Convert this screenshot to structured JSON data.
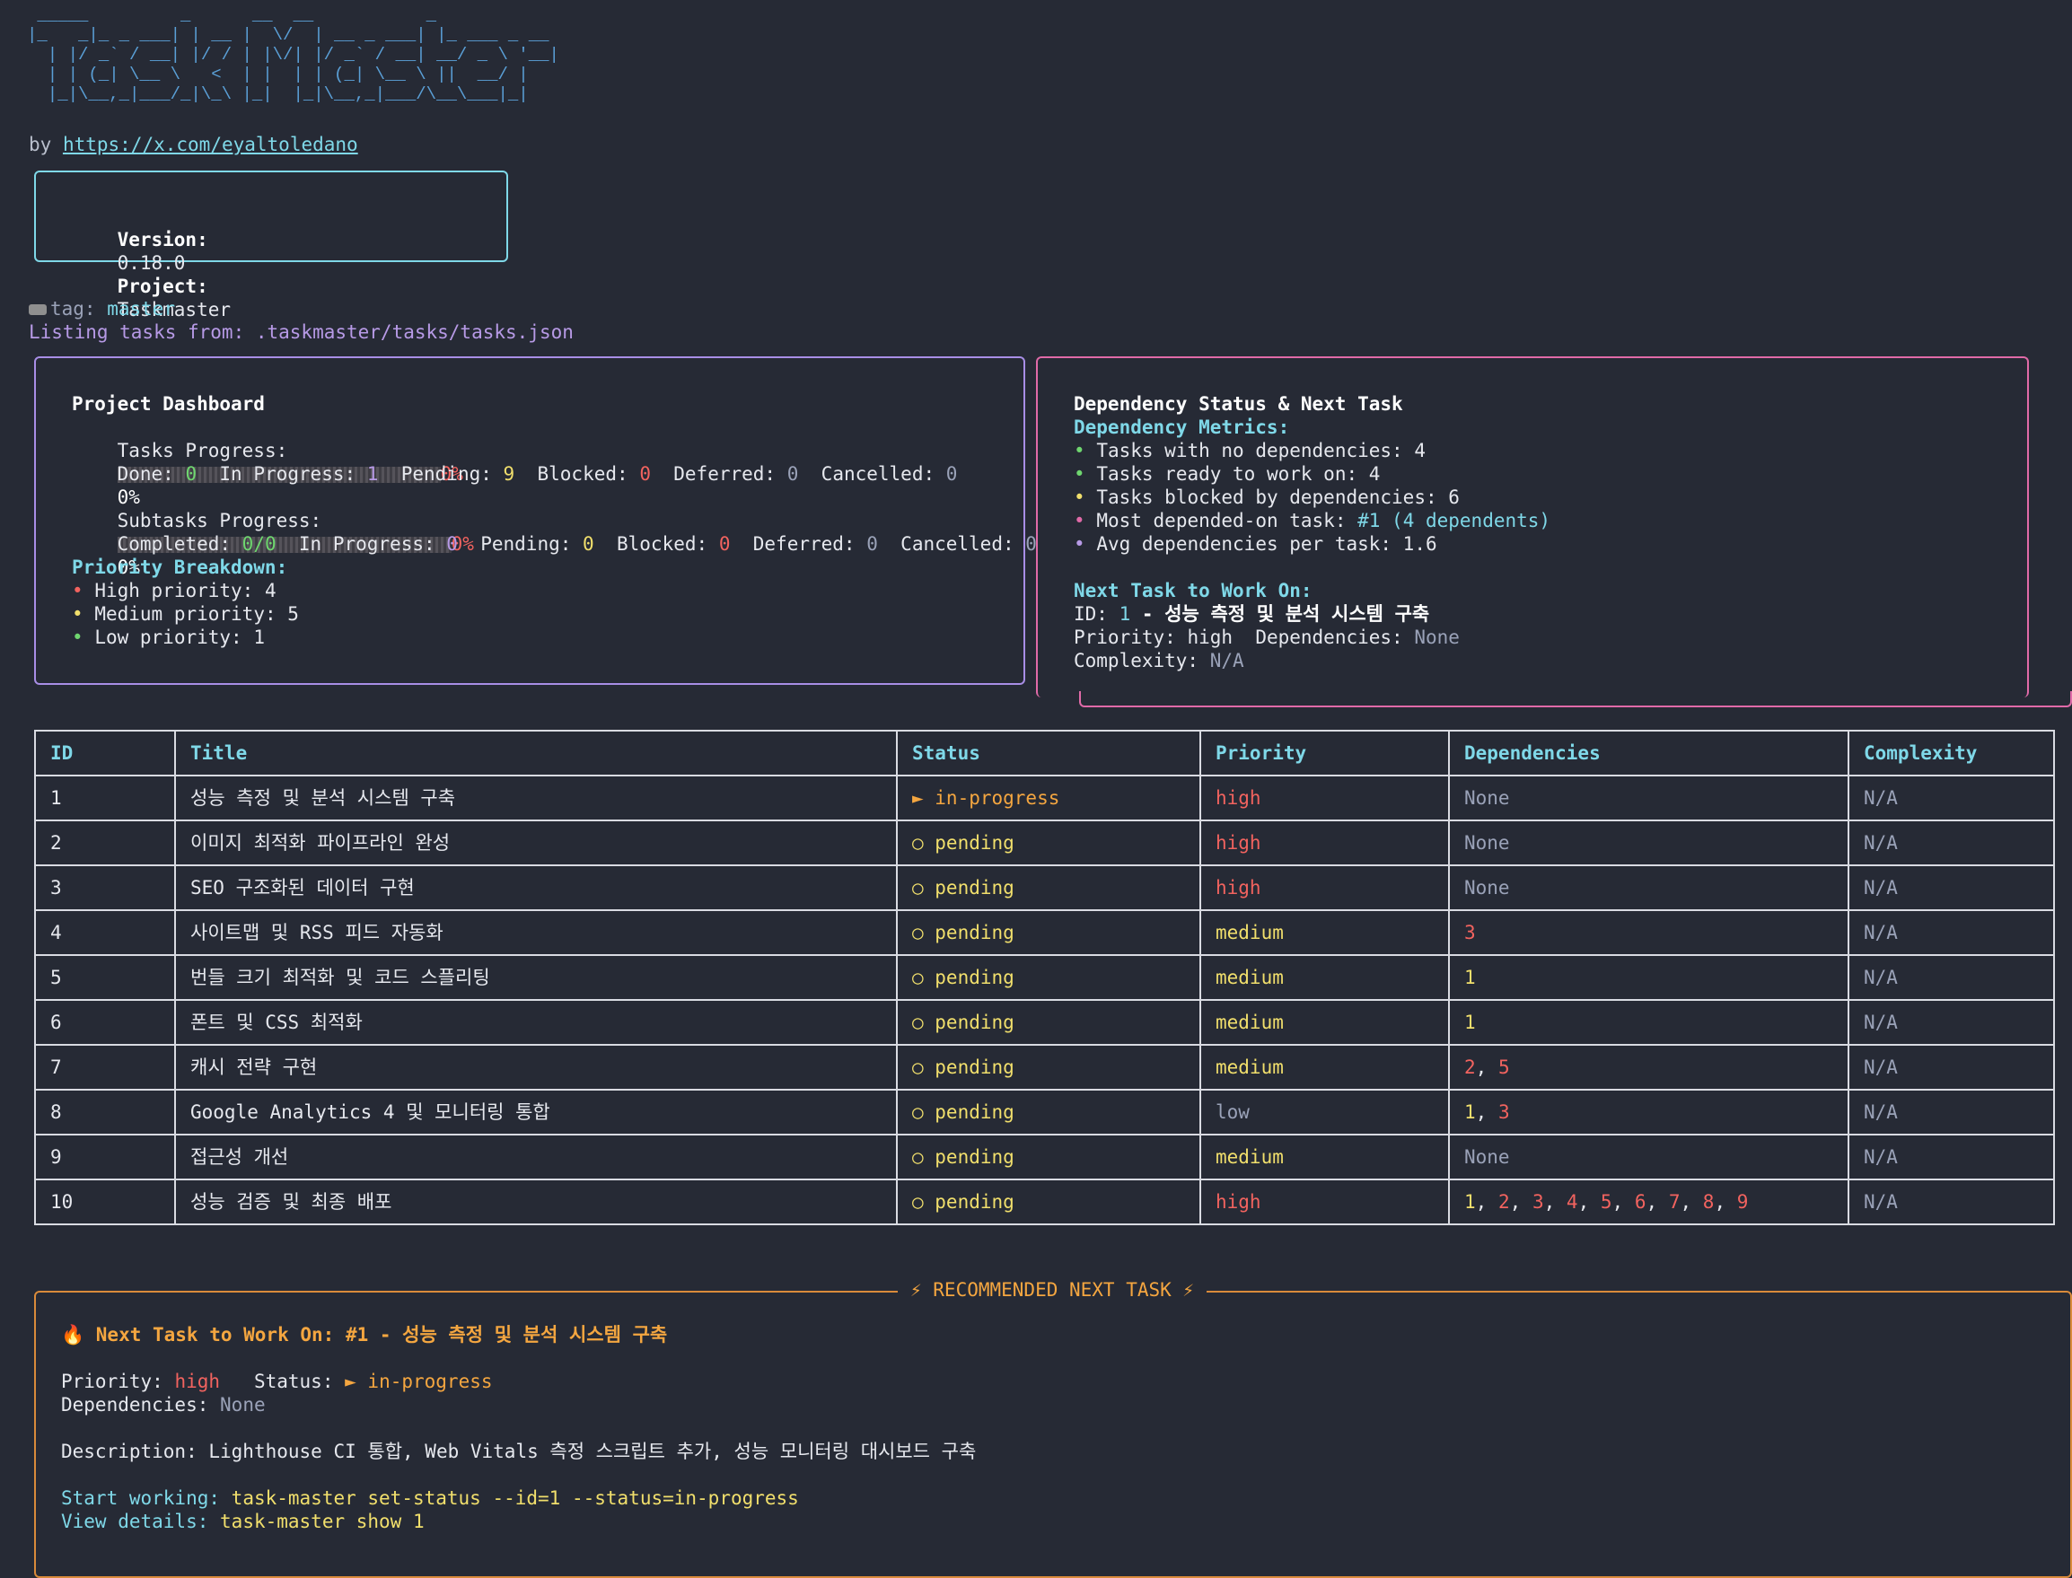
{
  "header": {
    "logo_ascii": " _____         _      __  __           _\n|_   _|_ _ ___| | __ |  \\/  | __ _ ___| |_ ___ _ __\n  | |/ _` / __| |/ / | |\\/| |/ _` / __| __/ _ \\ '__|\n  | | (_| \\__ \\   <  | |  | | (_| \\__ \\ ||  __/ |\n  |_|\\__,_|___/_|\\_\\ |_|  |_|\\__,_|___/\\__\\___|_|",
    "by_label": "by",
    "author_link": "https://x.com/eyaltoledano",
    "version_label": "Version:",
    "version": "0.18.0",
    "project_label": "Project:",
    "project": "Taskmaster",
    "tag_label": "tag:",
    "tag": "master",
    "listing_text": "Listing tasks from: .taskmaster/tasks/tasks.json"
  },
  "dashboard": {
    "title": "Project Dashboard",
    "tasks_progress_label": "Tasks Progress:",
    "tasks_progress_pct": "0%",
    "tasks_progress_pct2": "0%",
    "done_label": "Done:",
    "done": "0",
    "inprogress_label": "In Progress:",
    "inprogress": "1",
    "pending_label": "Pending:",
    "pending": "9",
    "blocked_label": "Blocked:",
    "blocked": "0",
    "deferred_label": "Deferred:",
    "deferred": "0",
    "cancelled_label": "Cancelled:",
    "cancelled": "0",
    "subtasks_progress_label": "Subtasks Progress:",
    "subtasks_progress_pct": "0%",
    "subtasks_progress_pct2": "0%",
    "completed_label": "Completed:",
    "completed": "0/0",
    "s_inprogress_label": "In Progress:",
    "s_inprogress": "0",
    "s_pending_label": "Pending:",
    "s_pending": "0",
    "s_blocked_label": "Blocked:",
    "s_blocked": "0",
    "s_deferred_label": "Deferred:",
    "s_deferred": "0",
    "s_cancelled_label": "Cancelled:",
    "s_cancelled": "0",
    "priority_title": "Priority Breakdown:",
    "high": "High priority: 4",
    "medium": "Medium priority: 5",
    "low": "Low priority: 1"
  },
  "dependency": {
    "title": "Dependency Status & Next Task",
    "metrics_title": "Dependency Metrics:",
    "no_deps": "Tasks with no dependencies: 4",
    "ready": "Tasks ready to work on: 4",
    "blocked": "Tasks blocked by dependencies: 6",
    "most_label": "Most depended-on task:",
    "most_value": "#1 (4 dependents)",
    "avg": "Avg dependencies per task: 1.6",
    "next_title": "Next Task to Work On:",
    "id_label": "ID:",
    "id": "1",
    "task_title": "- 성능 측정 및 분석 시스템 구축",
    "priority_label": "Priority:",
    "priority": "high",
    "deps_label": "Dependencies:",
    "deps": "None",
    "complexity_label": "Complexity:",
    "complexity": "N/A"
  },
  "table": {
    "headers": [
      "ID",
      "Title",
      "Status",
      "Priority",
      "Dependencies",
      "Complexity"
    ],
    "rows": [
      {
        "id": "1",
        "title": "성능 측정 및 분석 시스템 구축",
        "status": "► in-progress",
        "priority": "high",
        "complexity": "N/A"
      },
      {
        "id": "2",
        "title": "이미지 최적화 파이프라인 완성",
        "status": "○ pending",
        "priority": "high",
        "complexity": "N/A"
      },
      {
        "id": "3",
        "title": "SEO 구조화된 데이터 구현",
        "status": "○ pending",
        "priority": "high",
        "complexity": "N/A"
      },
      {
        "id": "4",
        "title": "사이트맵 및 RSS 피드 자동화",
        "status": "○ pending",
        "priority": "medium",
        "complexity": "N/A"
      },
      {
        "id": "5",
        "title": "번들 크기 최적화 및 코드 스플리팅",
        "status": "○ pending",
        "priority": "medium",
        "complexity": "N/A"
      },
      {
        "id": "6",
        "title": "폰트 및 CSS 최적화",
        "status": "○ pending",
        "priority": "medium",
        "complexity": "N/A"
      },
      {
        "id": "7",
        "title": "캐시 전략 구현",
        "status": "○ pending",
        "priority": "medium",
        "complexity": "N/A"
      },
      {
        "id": "8",
        "title": "Google Analytics 4 및 모니터링 통합",
        "status": "○ pending",
        "priority": "low",
        "complexity": "N/A"
      },
      {
        "id": "9",
        "title": "접근성 개선",
        "status": "○ pending",
        "priority": "medium",
        "complexity": "N/A"
      },
      {
        "id": "10",
        "title": "성능 검증 및 최종 배포",
        "status": "○ pending",
        "priority": "high",
        "complexity": "N/A"
      }
    ],
    "deps": {
      "r1": "None",
      "r2": "None",
      "r3": "None",
      "r4a": "3",
      "r5a": "1",
      "r6a": "1",
      "r7a": "2",
      "r7b": "5",
      "r8a": "1",
      "r8b": "3",
      "r9": "None",
      "r10": [
        "1",
        "2",
        "3",
        "4",
        "5",
        "6",
        "7",
        "8",
        "9"
      ],
      "sep": ","
    }
  },
  "recommended": {
    "frame_title": "⚡ RECOMMENDED NEXT TASK ⚡",
    "headline": "🔥 Next Task to Work On: #1 - 성능 측정 및 분석 시스템 구축",
    "priority_label": "Priority:",
    "priority": "high",
    "status_label": "Status:",
    "status": "► in-progress",
    "deps_label": "Dependencies:",
    "deps": "None",
    "description_label": "Description:",
    "description": "Lighthouse CI 통합, Web Vitals 측정 스크립트 추가, 성능 모니터링 대시보드 구축",
    "start_label": "Start working:",
    "start_cmd": "task-master set-status --id=1 --status=in-progress",
    "view_label": "View details:",
    "view_cmd": "task-master show 1"
  },
  "colors": {
    "background": "#262a35",
    "cyan": "#7fd8e8",
    "purple_border": "#a88ee6",
    "pink_border": "#e06aa8",
    "orange": "#f4a640",
    "red": "#f2635f",
    "yellow": "#f1df6c",
    "green": "#6fd66f"
  }
}
